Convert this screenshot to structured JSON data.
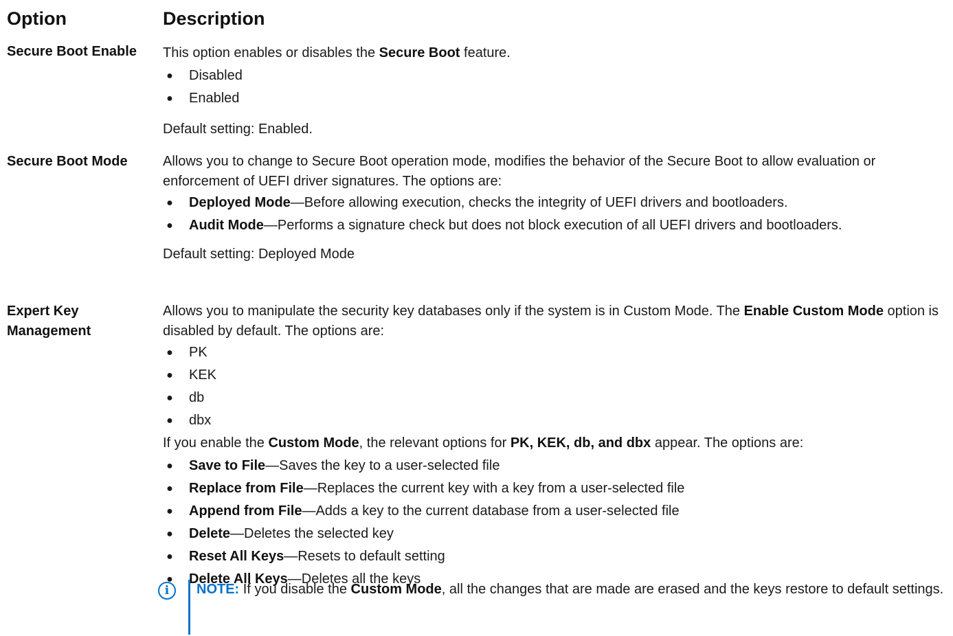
{
  "header": {
    "option": "Option",
    "description": "Description"
  },
  "rows": [
    {
      "option": "Secure Boot Enable",
      "intro_pre": "This option enables or disables the ",
      "intro_bold": "Secure Boot",
      "intro_post": " feature.",
      "items": [
        "Disabled",
        "Enabled"
      ],
      "default": "Default setting: Enabled."
    },
    {
      "option": "Secure Boot Mode",
      "intro": "Allows you to change to Secure Boot operation mode, modifies the behavior of the Secure Boot to allow evaluation or enforcement of UEFI driver signatures. The options are:",
      "items": [
        {
          "term": "Deployed Mode",
          "text": "—Before allowing execution, checks the integrity of UEFI drivers and bootloaders."
        },
        {
          "term": "Audit Mode",
          "text": "—Performs a signature check but does not block execution of all UEFI drivers and bootloaders."
        }
      ],
      "default": "Default setting: Deployed Mode"
    },
    {
      "option": "Expert Key Management",
      "intro_pre": "Allows you to manipulate the security key databases only if the system is in Custom Mode. The ",
      "intro_bold": "Enable Custom Mode",
      "intro_post": " option is disabled by default. The options are:",
      "items": [
        "PK",
        "KEK",
        "db",
        "dbx"
      ],
      "custom_pre": "If you enable the ",
      "custom_bold1": "Custom Mode",
      "custom_mid": ", the relevant options for ",
      "custom_bold2": "PK, KEK, db, and dbx",
      "custom_post": " appear. The options are:",
      "actions": [
        {
          "term": "Save to File",
          "text": "—Saves the key to a user-selected file"
        },
        {
          "term": "Replace from File",
          "text": "—Replaces the current key with a key from a user-selected file"
        },
        {
          "term": "Append from File",
          "text": "—Adds a key to the current database from a user-selected file"
        },
        {
          "term": "Delete",
          "text": "—Deletes the selected key"
        },
        {
          "term": "Reset All Keys",
          "text": "—Resets to default setting"
        },
        {
          "term": "Delete All Keys",
          "text": "—Deletes all the keys"
        }
      ],
      "note": {
        "label": "NOTE:",
        "pre": " If you disable the ",
        "bold": "Custom Mode",
        "post": ", all the changes that are made are erased and the keys restore to default settings."
      }
    }
  ],
  "icons": {
    "bullet": "bullet-icon",
    "note": "info-icon"
  },
  "colors": {
    "accent": "#0672cb",
    "text": "#1a1a1a"
  }
}
